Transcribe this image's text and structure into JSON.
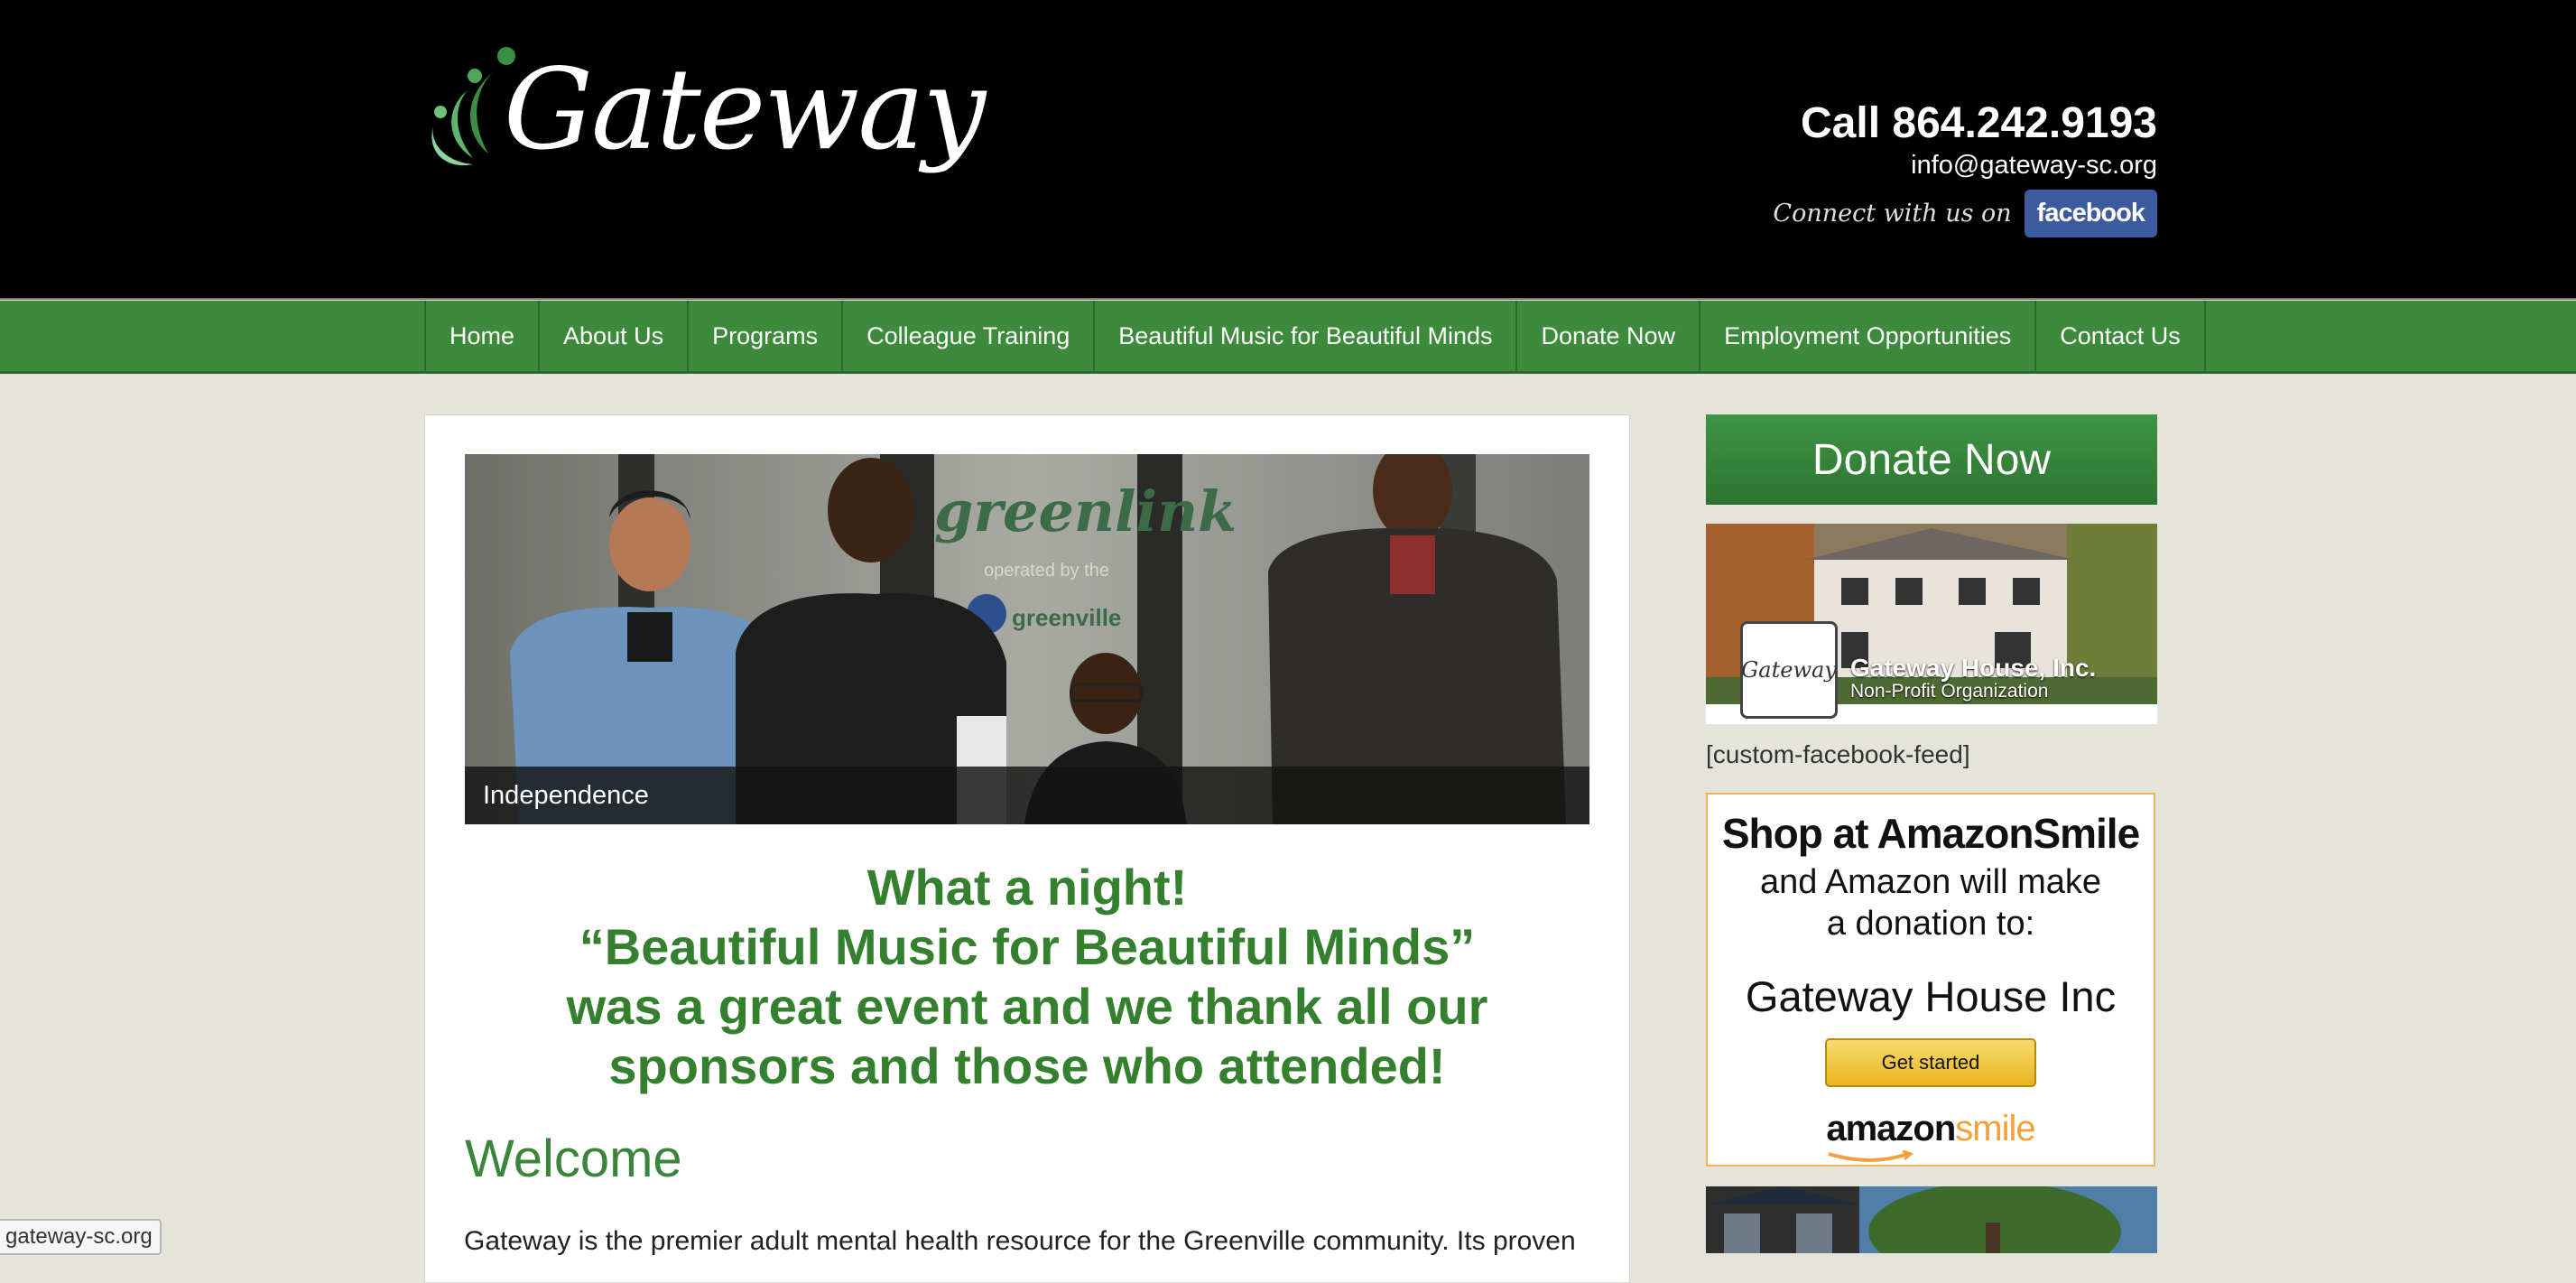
{
  "header": {
    "logo_text": "Gateway",
    "phone": "Call 864.242.9193",
    "email": "info@gateway-sc.org",
    "connect_text": "Connect with us on",
    "facebook_label": "facebook"
  },
  "nav": {
    "items": [
      {
        "label": "Home"
      },
      {
        "label": "About Us"
      },
      {
        "label": "Programs"
      },
      {
        "label": "Colleague Training"
      },
      {
        "label": "Beautiful Music for Beautiful Minds"
      },
      {
        "label": "Donate Now"
      },
      {
        "label": "Employment Opportunities"
      },
      {
        "label": "Contact Us"
      }
    ]
  },
  "slider": {
    "caption": "Independence",
    "sign_text": "greenlink",
    "sign_subtext": "operated by the",
    "sign_city": "greenville"
  },
  "main": {
    "headline": [
      "What a night!",
      "“Beautiful Music for Beautiful Minds”",
      "was a great event and we thank all our",
      "sponsors and those who attended!"
    ],
    "welcome_heading": "Welcome",
    "intro_text": "Gateway is the premier adult mental health resource for the Greenville community. Its proven"
  },
  "sidebar": {
    "donate_label": "Donate Now",
    "fb_page_name": "Gateway House, Inc.",
    "fb_page_type": "Non-Profit Organization",
    "fb_avatar_text": "Gateway",
    "shortcode": "[custom-facebook-feed]",
    "amazon": {
      "title": "Shop at AmazonSmile",
      "subtitle_1": "and Amazon will make",
      "subtitle_2": "a donation to:",
      "org": "Gateway House Inc",
      "button": "Get started",
      "logo_main": "amazon",
      "logo_smile": "smile"
    }
  },
  "status_bar": {
    "url": "gateway-sc.org"
  },
  "colors": {
    "brand_green": "#3d8a3d",
    "headline_green": "#35802f",
    "header_bg": "#000000",
    "page_bg": "#e4e4da",
    "facebook_blue": "#3b5aa0",
    "amazon_border": "#f0b45a"
  }
}
